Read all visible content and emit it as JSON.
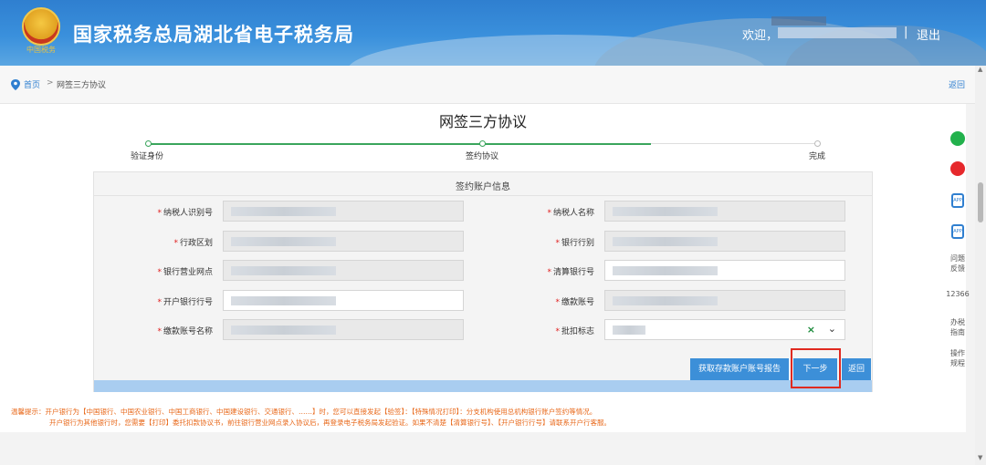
{
  "header": {
    "site_title": "国家税务总局湖北省电子税务局",
    "welcome": "欢迎，",
    "separator": "|",
    "logout": "退出",
    "emblem_text": "中国税务"
  },
  "breadcrumb": {
    "home": "首页",
    "arrow": ">",
    "current": "网签三方协议",
    "back": "返回"
  },
  "page_title": "网签三方协议",
  "steps": [
    {
      "label": "验证身份",
      "status": "done"
    },
    {
      "label": "签约协议",
      "status": "current"
    },
    {
      "label": "完成",
      "status": "todo"
    }
  ],
  "form": {
    "section_title": "签约账户信息",
    "left_fields": [
      {
        "label": "纳税人识别号",
        "editable": false
      },
      {
        "label": "行政区划",
        "editable": false
      },
      {
        "label": "银行营业网点",
        "editable": false
      },
      {
        "label": "开户银行行号",
        "editable": true
      },
      {
        "label": "缴款账号名称",
        "editable": false
      }
    ],
    "right_fields": [
      {
        "label": "纳税人名称",
        "editable": false
      },
      {
        "label": "银行行别",
        "editable": false
      },
      {
        "label": "清算银行号",
        "editable": true
      },
      {
        "label": "缴款账号",
        "editable": false
      },
      {
        "label": "批扣标志",
        "editable": true
      }
    ],
    "required_mark": "*",
    "select_clear": "×",
    "select_arrow": "⌄"
  },
  "buttons": {
    "get_report": "获取存款账户账号报告",
    "next": "下一步",
    "back": "返回"
  },
  "tips": {
    "line1": "温馨提示：开户银行为【中国银行、中国农业银行、中国工商银行、中国建设银行、交通银行、……】时，您可以直接发起【验签】：【特殊情况打印】：分支机构使用总机构银行账户签约等情况。",
    "line2": "开户银行为其他银行时，您需要【打印】委托扣款协议书，前往银行营业网点录入协议后，再登录电子税务局发起验证。如果不清楚【清算银行号】、【开户银行行号】请联系开户行客服。"
  },
  "sidebar": {
    "wechat_icon": "wechat-icon",
    "weibo_icon": "weibo-icon",
    "app1_label": "APP",
    "app2_label": "APP",
    "faq": "问题\n反馈",
    "hotline": "12366",
    "guide": "办税\n指南",
    "manual": "操作\n规程"
  },
  "colors": {
    "header_blue": "#3a90dc",
    "step_green": "#3aa55c",
    "button_blue": "#3c8fd8",
    "highlight_red": "#e0291f",
    "tip_orange": "#e8681a"
  }
}
